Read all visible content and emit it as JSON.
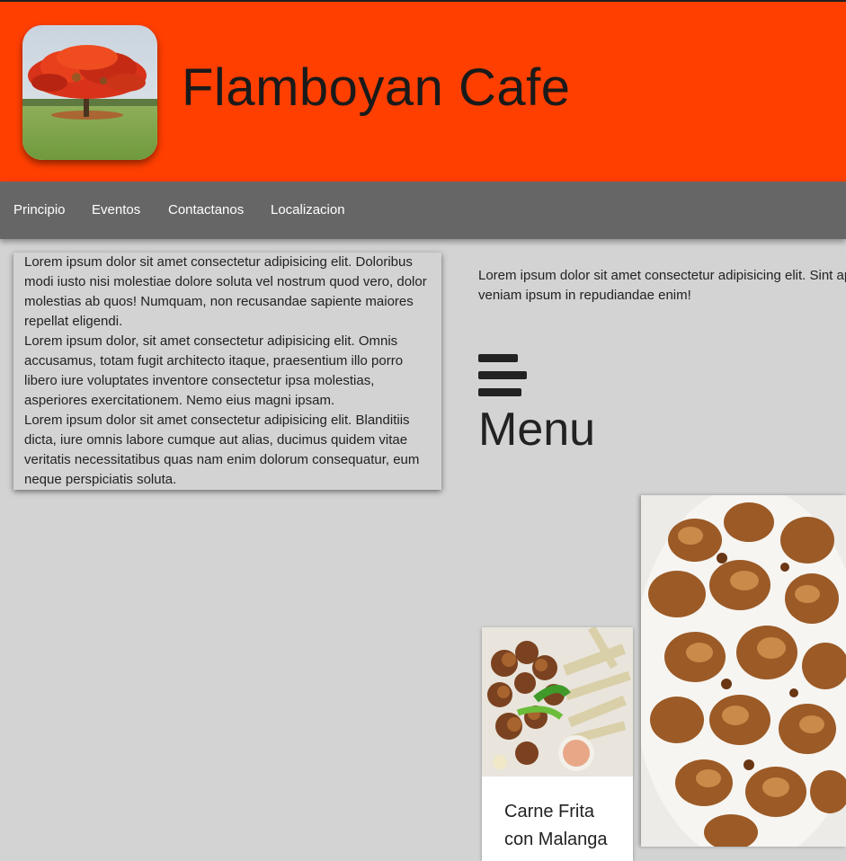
{
  "site": {
    "title": "Flamboyan Cafe",
    "logo_icon": "flamboyan-tree-photo"
  },
  "colors": {
    "header_bg": "#ff3f00",
    "nav_bg": "#666666",
    "page_bg": "#d3d3d3"
  },
  "nav": {
    "items": [
      {
        "label": "Principio"
      },
      {
        "label": "Eventos"
      },
      {
        "label": "Contactanos"
      },
      {
        "label": "Localizacion"
      }
    ]
  },
  "intro_card": {
    "paragraphs": [
      "Lorem ipsum dolor sit amet consectetur adipisicing elit. Doloribus modi iusto nisi molestiae dolore soluta vel nostrum quod vero, dolor molestias ab quos! Numquam, non recusandae sapiente maiores repellat eligendi.",
      "Lorem ipsum dolor, sit amet consectetur adipisicing elit. Omnis accusamus, totam fugit architecto itaque, praesentium illo porro libero iure voluptates inventore consectetur ipsa molestias, asperiores exercitationem. Nemo eius magni ipsam.",
      "Lorem ipsum dolor sit amet consectetur adipisicing elit. Blanditiis dicta, iure omnis labore cumque aut alias, ducimus quidem vitae veritatis necessitatibus quas nam enim dolorum consequatur, eum neque perspiciatis soluta."
    ]
  },
  "right_section": {
    "line1": "Lorem ipsum dolor sit amet consectetur adipisicing elit. Sint ap",
    "line2": "veniam ipsum in repudiandae enim!",
    "menu_icon": "hamburger-menu-icon",
    "menu_label": "Menu"
  },
  "dishes": [
    {
      "name": "Carne Frita con Malanga",
      "image": "carne-frita-photo"
    }
  ],
  "featured_photo": "fried-pork-photo"
}
